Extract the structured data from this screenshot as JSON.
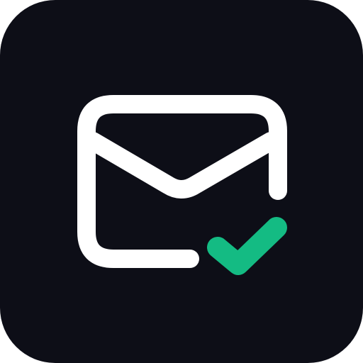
{
  "icon": {
    "name": "mail-verified-icon",
    "background_color": "#0d0e17",
    "envelope_color": "#ffffff",
    "check_color": "#14bb83"
  }
}
